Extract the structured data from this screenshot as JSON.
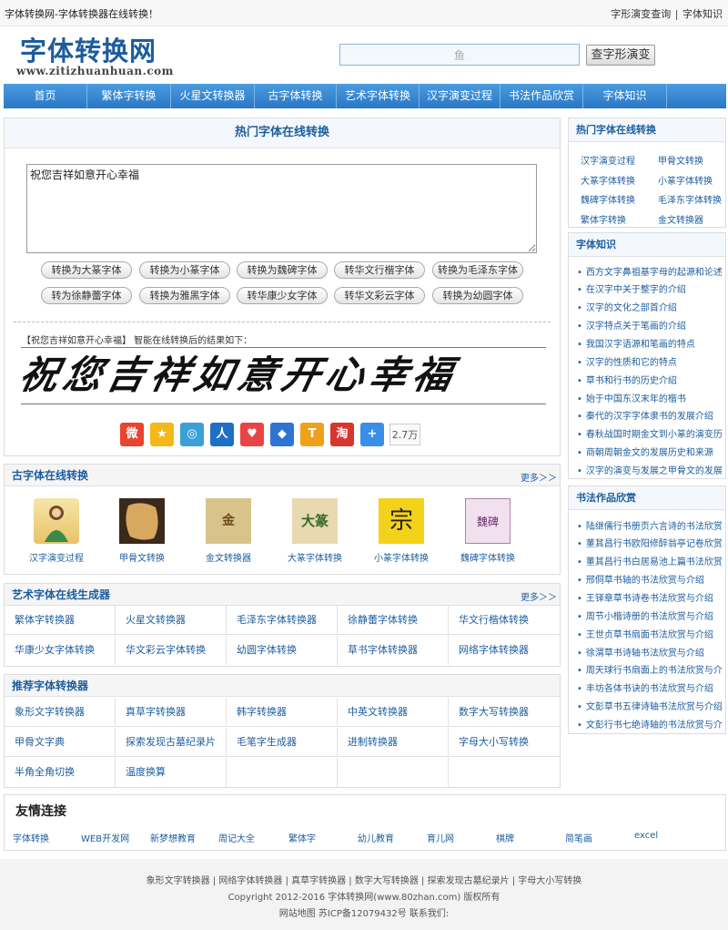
{
  "topbar": {
    "title": "字体转换网-字体转换器在线转换！",
    "links": [
      "字形演变查询",
      "字体知识"
    ]
  },
  "logo": {
    "cn": "字体转换网",
    "en": "www.zitizhuanhuan.com"
  },
  "search": {
    "value": "鱼",
    "button": "查字形演变"
  },
  "nav": [
    "首页",
    "繁体字转换",
    "火星文转换器",
    "古字体转换",
    "艺术字体转换",
    "汉字演变过程",
    "书法作品欣赏",
    "字体知识"
  ],
  "converter": {
    "title": "热门字体在线转换",
    "input_text": "祝您吉祥如意开心幸福",
    "buttons_row1": [
      "转换为大篆字体",
      "转换为小篆字体",
      "转换为魏碑字体",
      "转华文行楷字体",
      "转换为毛泽东字体"
    ],
    "buttons_row2": [
      "转为徐静蕾字体",
      "转换为雅黑字体",
      "转华康少女字体",
      "转华文彩云字体",
      "转换为幼圆字体"
    ],
    "result_label": "【祝您吉祥如意开心幸福】 智能在线转换后的结果如下：",
    "result_text": "祝您吉祥如意开心幸福",
    "share_count": "2.7万"
  },
  "ancient": {
    "title": "古字体在线转换",
    "more": "更多＞＞",
    "items": [
      "汉字演变过程",
      "甲骨文转换",
      "金文转换器",
      "大篆字体转换",
      "小篆字体转换",
      "魏碑字体转换"
    ],
    "thumb_glyphs": [
      "",
      "",
      "金",
      "大篆",
      "宗",
      "魏碑"
    ]
  },
  "art": {
    "title": "艺术字体在线生成器",
    "more": "更多＞＞",
    "rows": [
      [
        "繁体字转换器",
        "火星文转换器",
        "毛泽东字体转换器",
        "徐静蕾字体转换",
        "华文行楷体转换"
      ],
      [
        "华康少女字体转换",
        "华文彩云字体转换",
        "幼圆字体转换",
        "草书字体转换器",
        "网络字体转换器"
      ]
    ]
  },
  "recommend": {
    "title": "推荐字体转换器",
    "rows": [
      [
        "象形文字转换器",
        "真草字转换器",
        "韩字转换器",
        "中英文转换器",
        "数字大写转换器"
      ],
      [
        "甲骨文字典",
        "探索发现古墓纪录片",
        "毛笔字生成器",
        "进制转换器",
        "字母大小写转换"
      ],
      [
        "半角全角切换",
        "温度换算",
        "",
        "",
        ""
      ]
    ]
  },
  "sidebar": {
    "hot_title": "热门字体在线转换",
    "hot_items": [
      "汉字演变过程",
      "甲骨文转换",
      "大篆字体转换",
      "小篆字体转换",
      "魏碑字体转换",
      "毛泽东字体转换",
      "繁体字转换",
      "金文转换器"
    ],
    "knowledge_title": "字体知识",
    "knowledge_items": [
      "西方文字鼻祖基字母的起源和论述",
      "在汉字中关于整字的介绍",
      "汉字的文化之部首介绍",
      "汉字特点关于笔画的介绍",
      "我国汉字语源和笔画的特点",
      "汉字的性质和它的特点",
      "草书和行书的历史介绍",
      "始于中国东汉末年的楷书",
      "秦代的汉字字体隶书的发展介绍",
      "春秋战国时期金文到小篆的演变历",
      "商朝周朝金文的发展历史和来源",
      "汉字的演变与发展之甲骨文的发展"
    ],
    "calligraphy_title": "书法作品欣赏",
    "calligraphy_items": [
      "陆继儒行书册页六言诗的书法欣赏",
      "董其昌行书欧阳修醉翁亭记卷欣赏",
      "董其昌行书白居易池上篇书法欣赏",
      "邢侗草书轴的书法欣赏与介绍",
      "王铎章草书诗卷书法欣赏与介绍",
      "周节小楷诗册的书法欣赏与介绍",
      "王世贞草书扇面书法欣赏与介绍",
      "徐渭草书诗轴书法欣赏与介绍",
      "周天球行书扇面上的书法欣赏与介",
      "丰坊各体书诀的书法欣赏与介绍",
      "文彭草书五律诗轴书法欣赏与介绍",
      "文彭行书七绝诗轴的书法欣赏与介"
    ]
  },
  "friends": {
    "title": "友情连接",
    "links": [
      "字体转换",
      "WEB开发网",
      "新梦想教育",
      "周记大全",
      "繁体字",
      "幼儿教育",
      "育儿网",
      "棋牌",
      "简笔画",
      "excel"
    ]
  },
  "footer": {
    "links_line": "象形文字转换器 | 网络字体转换器 | 真草字转换器 | 数字大写转换器 | 探索发现古墓纪录片 | 字母大小写转换",
    "copyright": "Copyright 2012-2016 字体转换网(www.80zhan.com) 版权所有",
    "icp": "网站地图 苏ICP备12079432号 联系我们:"
  },
  "colors": {
    "accent": "#1d5d9e",
    "nav": "#2a77c4"
  }
}
